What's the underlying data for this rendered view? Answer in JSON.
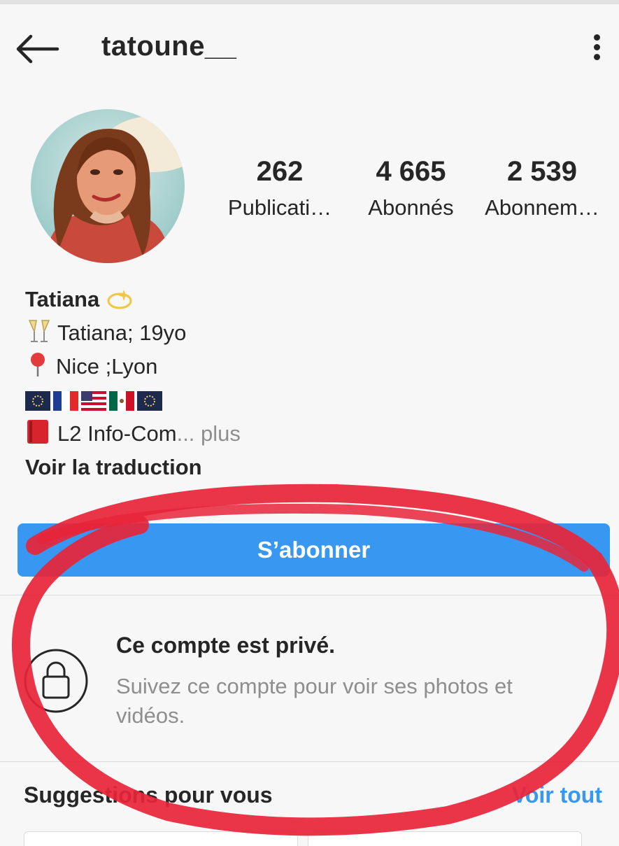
{
  "header": {
    "username": "tatoune__"
  },
  "stats": [
    {
      "value": "262",
      "label": "Publicati…"
    },
    {
      "value": "4 665",
      "label": "Abonnés"
    },
    {
      "value": "2 539",
      "label": "Abonnem…"
    }
  ],
  "bio": {
    "name": "Tatiana",
    "line1": "Tatiana; 19yo",
    "line2": "Nice ;Lyon",
    "line4": "L2 Info-Com",
    "more_ellipsis": "...",
    "more_link": " plus",
    "translate": "Voir la traduction"
  },
  "follow_button": "S’abonner",
  "private": {
    "title": "Ce compte est privé.",
    "subtitle": "Suivez ce compte pour voir ses photos et vidéos."
  },
  "suggestions": {
    "title": "Suggestions pour vous",
    "see_all": "Voir tout"
  },
  "colors": {
    "accent": "#3897f0",
    "annotation": "#e8243a"
  },
  "icons": [
    "back-arrow-icon",
    "more-options-icon",
    "sparkle-emoji",
    "champagne-emoji",
    "pin-emoji",
    "fireworks-emoji",
    "flag-france",
    "flag-usa",
    "flag-mexico",
    "book-emoji",
    "lock-icon"
  ]
}
